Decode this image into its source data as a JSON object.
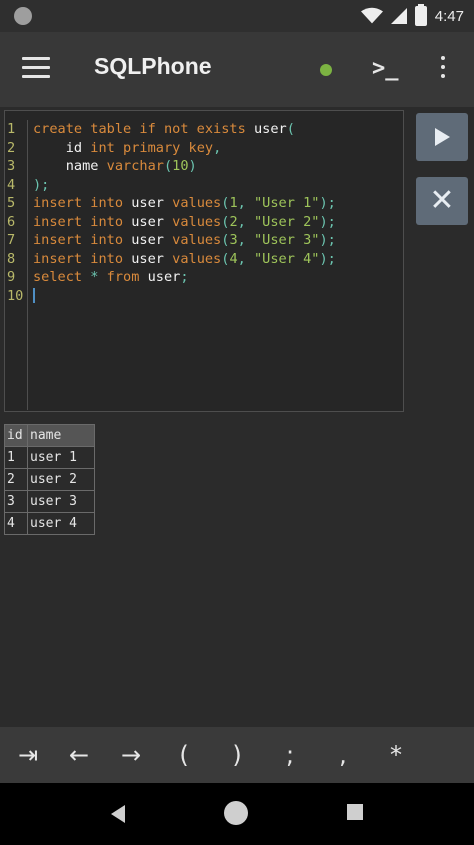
{
  "status": {
    "time": "4:47",
    "icons": [
      "notification-dot-icon",
      "wifi-icon",
      "signal-icon",
      "battery-icon"
    ]
  },
  "appbar": {
    "title": "SQLPhone",
    "connection_color": "#7cb342",
    "icons": [
      "menu-icon",
      "terminal-icon",
      "more-vert-icon"
    ]
  },
  "editor": {
    "line_numbers": [
      "1",
      "2",
      "3",
      "4",
      "5",
      "6",
      "7",
      "8",
      "9",
      "10"
    ],
    "lines": [
      [
        [
          "kw",
          "create table if not exists "
        ],
        [
          "id",
          "user"
        ],
        [
          "pu",
          "("
        ]
      ],
      [
        [
          "id",
          "    id "
        ],
        [
          "kw",
          "int primary key"
        ],
        [
          "pu",
          ","
        ]
      ],
      [
        [
          "id",
          "    name "
        ],
        [
          "kw",
          "varchar"
        ],
        [
          "pu",
          "("
        ],
        [
          "num",
          "10"
        ],
        [
          "pu",
          ")"
        ]
      ],
      [
        [
          "pu",
          ");"
        ]
      ],
      [
        [
          "kw",
          "insert into "
        ],
        [
          "id",
          "user "
        ],
        [
          "kw",
          "values"
        ],
        [
          "pu",
          "("
        ],
        [
          "num",
          "1"
        ],
        [
          "pu",
          ", "
        ],
        [
          "str",
          "\"User 1\""
        ],
        [
          "pu",
          ");"
        ]
      ],
      [
        [
          "kw",
          "insert into "
        ],
        [
          "id",
          "user "
        ],
        [
          "kw",
          "values"
        ],
        [
          "pu",
          "("
        ],
        [
          "num",
          "2"
        ],
        [
          "pu",
          ", "
        ],
        [
          "str",
          "\"User 2\""
        ],
        [
          "pu",
          ");"
        ]
      ],
      [
        [
          "kw",
          "insert into "
        ],
        [
          "id",
          "user "
        ],
        [
          "kw",
          "values"
        ],
        [
          "pu",
          "("
        ],
        [
          "num",
          "3"
        ],
        [
          "pu",
          ", "
        ],
        [
          "str",
          "\"User 3\""
        ],
        [
          "pu",
          ");"
        ]
      ],
      [
        [
          "kw",
          "insert into "
        ],
        [
          "id",
          "user "
        ],
        [
          "kw",
          "values"
        ],
        [
          "pu",
          "("
        ],
        [
          "num",
          "4"
        ],
        [
          "pu",
          ", "
        ],
        [
          "str",
          "\"User 4\""
        ],
        [
          "pu",
          ");"
        ]
      ],
      [
        [
          "kw",
          "select "
        ],
        [
          "pu",
          "* "
        ],
        [
          "kw",
          "from "
        ],
        [
          "id",
          "user"
        ],
        [
          "pu",
          ";"
        ]
      ],
      []
    ]
  },
  "actions": {
    "run_icon": "play-icon",
    "clear_label": "✕"
  },
  "results": {
    "headers": [
      "id",
      "name"
    ],
    "rows": [
      [
        "1",
        "user 1"
      ],
      [
        "2",
        "user 2"
      ],
      [
        "3",
        "user 3"
      ],
      [
        "4",
        "user 4"
      ]
    ]
  },
  "keys": [
    {
      "name": "tab-key",
      "label": "⇥"
    },
    {
      "name": "left-arrow-key",
      "label": "←"
    },
    {
      "name": "right-arrow-key",
      "label": "→"
    },
    {
      "name": "open-paren-key",
      "label": "("
    },
    {
      "name": "close-paren-key",
      "label": ")"
    },
    {
      "name": "semicolon-key",
      "label": ";"
    },
    {
      "name": "comma-key",
      "label": ","
    },
    {
      "name": "asterisk-key",
      "label": "*"
    }
  ],
  "colors": {
    "keyword": "#d98a3c",
    "string": "#9ec45a",
    "punct": "#6cc5b0",
    "button": "#5f6b78"
  }
}
